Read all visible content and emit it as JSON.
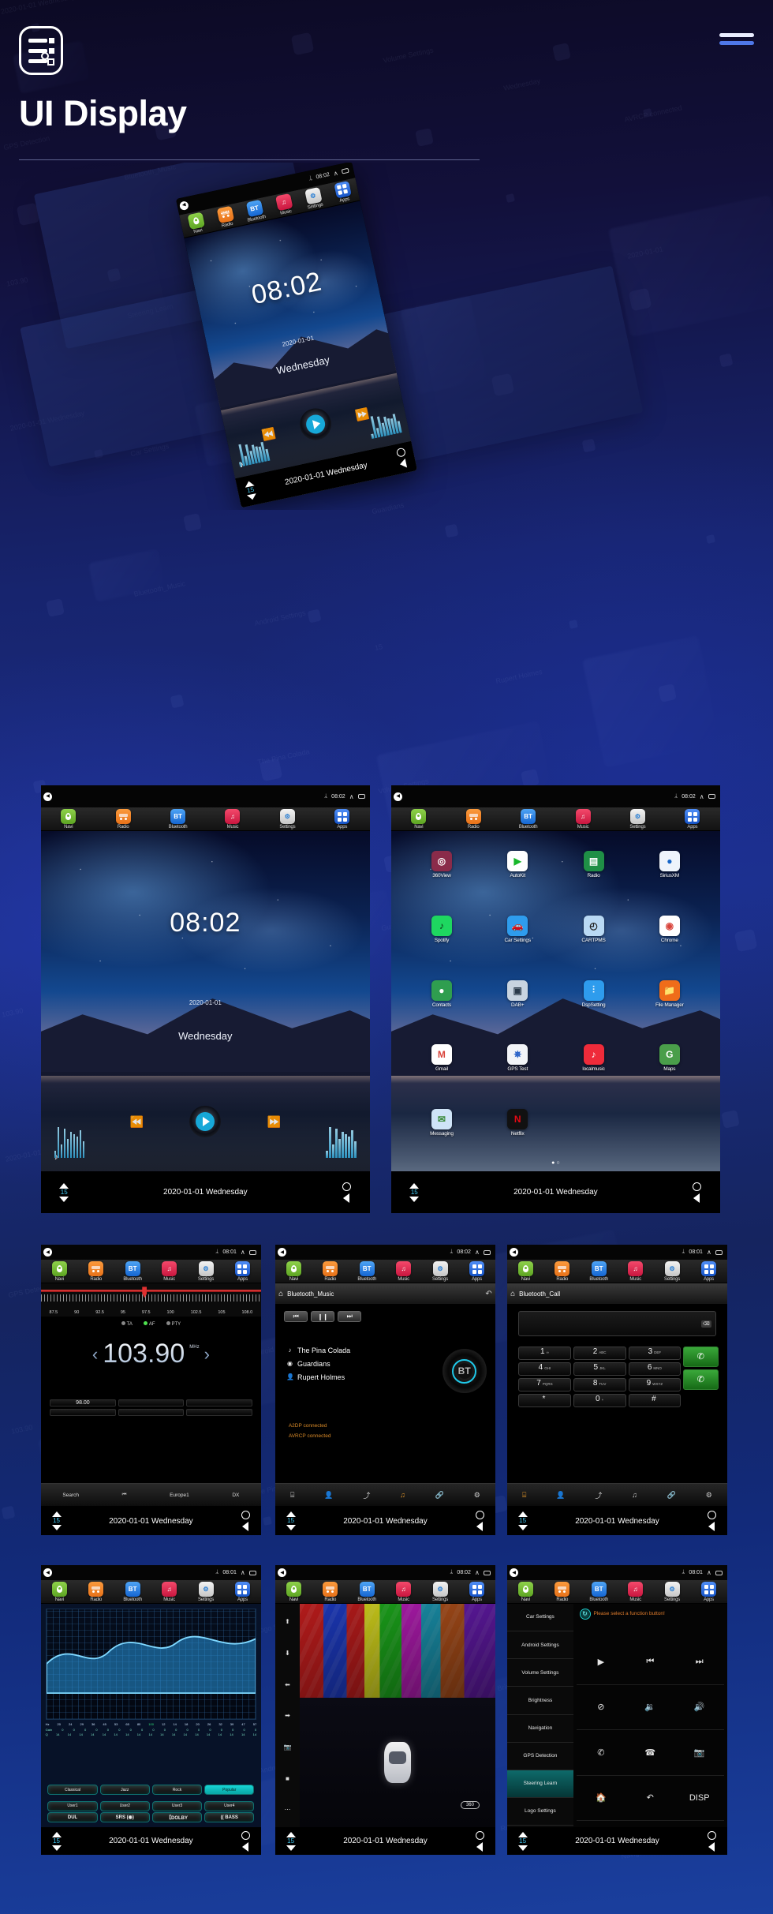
{
  "header": {
    "title": "UI Display",
    "logo_name": "ui-display-logo",
    "menu_name": "hamburger-menu"
  },
  "statusbar": {
    "time_0802": "08:02",
    "time_0801": "08:01",
    "bt_glyph": "B",
    "back_glyph": "◀",
    "chevron_glyph": "∧"
  },
  "appbar": {
    "items": [
      {
        "label": "Navi",
        "icon": "navi-icon"
      },
      {
        "label": "Radio",
        "icon": "radio-icon"
      },
      {
        "label": "Bluetooth",
        "icon": "bluetooth-icon",
        "text": "BT"
      },
      {
        "label": "Music",
        "icon": "music-disc-icon"
      },
      {
        "label": "Music",
        "icon": "music-note-icon",
        "text": "♫"
      },
      {
        "label": "Settings",
        "icon": "settings-gear-icon",
        "text": "⚙"
      },
      {
        "label": "Apps",
        "icon": "apps-grid-icon"
      }
    ]
  },
  "bottombar": {
    "volume": "15",
    "date": "2020-01-01  Wednesday",
    "up_icon": "volume-up-icon",
    "down_icon": "volume-down-icon",
    "home_icon": "home-circle-icon",
    "back_icon": "back-triangle-icon"
  },
  "home_screen": {
    "time": "08:02",
    "date": "2020-01-01",
    "weekday": "Wednesday",
    "prev_icon": "previous-track-icon",
    "play_icon": "play-button-icon",
    "next_icon": "next-track-icon",
    "headphone_icon": "headphone-icon",
    "prev_glyph": "⏪",
    "next_glyph": "⏩",
    "headphone_glyph": "🎧"
  },
  "apps_screen": {
    "apps": [
      {
        "label": "360View",
        "icon": "360view-icon",
        "glyph": "◎",
        "bg": "#8a2b4a"
      },
      {
        "label": "AutoKit",
        "icon": "autokit-icon",
        "glyph": "▶",
        "bg": "#ffffff",
        "fg": "#17b82a"
      },
      {
        "label": "Radio",
        "icon": "radio-app-icon",
        "glyph": "▤",
        "bg": "#1f8f46"
      },
      {
        "label": "SiriusXM",
        "icon": "siriusxm-icon",
        "glyph": "●",
        "bg": "#eef4fb",
        "fg": "#1666c8"
      },
      {
        "label": "Spotify",
        "icon": "spotify-icon",
        "glyph": "♪",
        "bg": "#1ed760",
        "fg": "#0a2a12"
      },
      {
        "label": "Car Settings",
        "icon": "car-settings-icon",
        "glyph": "🚗",
        "bg": "#2e9ced"
      },
      {
        "label": "CARTPMS",
        "icon": "cartpms-icon",
        "glyph": "◴",
        "bg": "#b9d9f4",
        "fg": "#202020"
      },
      {
        "label": "Chrome",
        "icon": "chrome-icon",
        "glyph": "◉",
        "bg": "#ffffff",
        "fg": "#d9453c"
      },
      {
        "label": "Contacts",
        "icon": "contacts-icon",
        "glyph": "●",
        "bg": "#2f9e4f"
      },
      {
        "label": "DAB+",
        "icon": "dab-icon",
        "glyph": "▣",
        "bg": "#c8d4e0",
        "fg": "#2a3a4a"
      },
      {
        "label": "DspSetting",
        "icon": "dsp-setting-icon",
        "glyph": "⫶",
        "bg": "#2e9ced"
      },
      {
        "label": "File Manager",
        "icon": "file-manager-icon",
        "glyph": "📁",
        "bg": "#ef6c1a"
      },
      {
        "label": "Gmail",
        "icon": "gmail-icon",
        "glyph": "M",
        "bg": "#ffffff",
        "fg": "#d9453c"
      },
      {
        "label": "GPS Test",
        "icon": "gps-test-icon",
        "glyph": "✵",
        "bg": "#f2f4f8",
        "fg": "#2a62c8"
      },
      {
        "label": "localmusic",
        "icon": "localmusic-icon",
        "glyph": "♪",
        "bg": "#ef2b3a"
      },
      {
        "label": "Maps",
        "icon": "maps-icon",
        "glyph": "G",
        "bg": "#4a9e4a",
        "fg": "#ffffff"
      },
      {
        "label": "Messaging",
        "icon": "messaging-icon",
        "glyph": "✉",
        "bg": "#cfe4f7",
        "fg": "#3a8a3a"
      },
      {
        "label": "Netflix",
        "icon": "netflix-icon",
        "glyph": "N",
        "bg": "#111111",
        "fg": "#e50914"
      }
    ],
    "page_dots": "● ○"
  },
  "radio_screen": {
    "ticks": [
      "87.5",
      "90",
      "92.5",
      "95",
      "97.5",
      "100",
      "102.5",
      "105",
      "108.0"
    ],
    "rds": [
      {
        "label": "TA",
        "on": false
      },
      {
        "label": "AF",
        "on": true
      },
      {
        "label": "PTY",
        "on": false
      }
    ],
    "frequency": "103.90",
    "unit": "MHz",
    "prev_icon": "freq-prev-icon",
    "next_icon": "freq-next-icon",
    "presets": [
      "98.00",
      "",
      "",
      "",
      "",
      ""
    ],
    "controls": [
      "Search",
      "⏮",
      "Europe1",
      "DX"
    ],
    "band_pointer_icon": "band-pointer-icon"
  },
  "bt_music_screen": {
    "title": "Bluetooth_Music",
    "home_icon": "home-icon",
    "back_icon": "back-arrow-icon",
    "back_glyph": "↶",
    "controls": [
      {
        "icon": "prev-track-icon",
        "glyph": "⏮"
      },
      {
        "icon": "pause-icon",
        "glyph": "❙❙"
      },
      {
        "icon": "next-track-icon",
        "glyph": "⏭"
      }
    ],
    "track": "The Pina Colada",
    "album": "Guardians",
    "artist": "Rupert Holmes",
    "track_icon": "music-note-icon",
    "album_icon": "album-icon",
    "artist_icon": "person-icon",
    "status": [
      "A2DP connected",
      "AVRCP connected"
    ],
    "disc_label": "BT",
    "toolbar": [
      {
        "icon": "dialpad-icon",
        "glyph": "⌸",
        "active": false
      },
      {
        "icon": "contacts-icon",
        "glyph": "👤",
        "active": false
      },
      {
        "icon": "call-log-icon",
        "glyph": "⤴",
        "active": false
      },
      {
        "icon": "music-icon",
        "glyph": "♫",
        "active": true
      },
      {
        "icon": "link-icon",
        "glyph": "🔗",
        "active": false
      },
      {
        "icon": "settings-icon",
        "glyph": "⚙",
        "active": false
      }
    ]
  },
  "bt_call_screen": {
    "title": "Bluetooth_Call",
    "home_icon": "home-icon",
    "input_value": "",
    "backspace_icon": "backspace-icon",
    "backspace_glyph": "⌫",
    "keys": [
      {
        "num": "1",
        "sub": "∞"
      },
      {
        "num": "2",
        "sub": "ABC"
      },
      {
        "num": "3",
        "sub": "DEF"
      },
      {
        "num": "4",
        "sub": "GHI"
      },
      {
        "num": "5",
        "sub": "JKL"
      },
      {
        "num": "6",
        "sub": "MNO"
      },
      {
        "num": "7",
        "sub": "PQRS"
      },
      {
        "num": "8",
        "sub": "TUV"
      },
      {
        "num": "9",
        "sub": "WXYZ"
      },
      {
        "num": "*",
        "sub": ""
      },
      {
        "num": "0",
        "sub": "+"
      },
      {
        "num": "#",
        "sub": ""
      }
    ],
    "call_buttons": [
      {
        "icon": "call-answer-icon",
        "glyph": "✆"
      },
      {
        "icon": "call-dial-icon",
        "glyph": "✆"
      }
    ]
  },
  "eq_screen": {
    "hz_row": [
      "Hz",
      "20",
      "24",
      "29",
      "36",
      "45",
      "53",
      "65",
      "80",
      "100",
      "12",
      "14",
      "18",
      "20",
      "26",
      "32",
      "39",
      "47",
      "57"
    ],
    "hz_highlight_index": 9,
    "gain_row_label": "Gain",
    "q_row_label": "Q",
    "gain_values": [
      "0",
      "0",
      "0",
      "0",
      "0",
      "0",
      "0",
      "0",
      "0",
      "0",
      "0",
      "0",
      "0",
      "0",
      "0",
      "0",
      "0",
      "0"
    ],
    "q_values": [
      "14",
      "14",
      "14",
      "14",
      "14",
      "14",
      "14",
      "14",
      "14",
      "14",
      "14",
      "14",
      "14",
      "14",
      "14",
      "14",
      "14",
      "14"
    ],
    "effect_buttons": [
      "DUL",
      "SRS (◉)",
      "【DOLBY",
      "(( BASS"
    ],
    "presets_row1": [
      "Classical",
      "Jazz",
      "Rock",
      "Popular"
    ],
    "presets_row2": [
      "User1",
      "User2",
      "User3",
      "User4",
      "—"
    ],
    "active_preset": "Popular"
  },
  "view360_screen": {
    "side_icons": [
      {
        "icon": "camera-front-icon",
        "glyph": "⬆"
      },
      {
        "icon": "camera-rear-icon",
        "glyph": "⬇"
      },
      {
        "icon": "camera-left-icon",
        "glyph": "⬅"
      },
      {
        "icon": "camera-right-icon",
        "glyph": "➡"
      },
      {
        "icon": "camera-snap-icon",
        "glyph": "📷"
      },
      {
        "icon": "camera-record-icon",
        "glyph": "■"
      },
      {
        "icon": "camera-more-icon",
        "glyph": "⋯"
      }
    ],
    "badge": "360"
  },
  "car_settings_screen": {
    "menu": [
      {
        "label": "Car Settings",
        "active": false
      },
      {
        "label": "Android Settings",
        "active": false
      },
      {
        "label": "Volume Settings",
        "active": false
      },
      {
        "label": "Brightness",
        "active": false
      },
      {
        "label": "Navigation",
        "active": false
      },
      {
        "label": "GPS Detection",
        "active": false
      },
      {
        "label": "Steering Learn",
        "active": true
      },
      {
        "label": "Logo Settings",
        "active": false
      }
    ],
    "hint": "Please select a function button!",
    "hint_icon": "refresh-icon",
    "hint_glyph": "↻",
    "buttons": [
      {
        "icon": "play-icon",
        "glyph": "▶"
      },
      {
        "icon": "prev-icon",
        "glyph": "⏮"
      },
      {
        "icon": "next-icon",
        "glyph": "⏭"
      },
      {
        "icon": "mute-icon",
        "glyph": "⊘"
      },
      {
        "icon": "vol-down-icon",
        "glyph": "🔉"
      },
      {
        "icon": "vol-up-icon",
        "glyph": "🔊"
      },
      {
        "icon": "call-icon",
        "glyph": "✆"
      },
      {
        "icon": "hangup-icon",
        "glyph": "☎"
      },
      {
        "icon": "camera-icon",
        "glyph": "📷"
      },
      {
        "icon": "home-icon",
        "glyph": "🏠"
      },
      {
        "icon": "back-icon",
        "glyph": "↶"
      },
      {
        "icon": "disp-icon",
        "glyph": "DISP"
      }
    ]
  },
  "ghost_text": [
    "2020-01-01  Wednesday",
    "Bluetooth_Music",
    "The Pina Colada",
    "Guardians",
    "Rupert Holmes",
    "AVRCP connected",
    "103.90",
    "Car Settings",
    "Android Settings",
    "Volume Settings",
    "Brightness",
    "Navigation",
    "GPS Detection",
    "Steering Learn",
    "Logo Settings",
    "15",
    "Wednesday",
    "2020-01-01"
  ]
}
